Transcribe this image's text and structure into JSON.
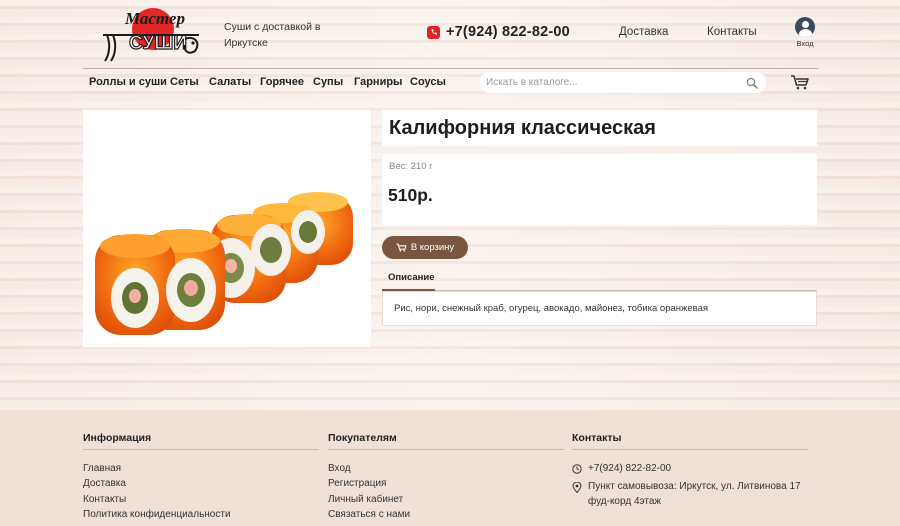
{
  "header": {
    "logo_text_top": "Мастер",
    "logo_text_bottom": "СУШИ",
    "tagline": "Суши с доставкой в Иркутске",
    "phone": "+7(924) 822-82-00",
    "nav": [
      "Доставка",
      "Контакты"
    ],
    "login_label": "Вход"
  },
  "menu": {
    "categories": [
      "Роллы и суши",
      "Сеты",
      "Салаты",
      "Горячее",
      "Супы",
      "Гарниры",
      "Соусы"
    ],
    "search_placeholder": "Искать в каталоге..."
  },
  "product": {
    "title": "Калифорния классическая",
    "weight": "Вес: 210 г",
    "price": "510р.",
    "buy_label": "В корзину",
    "tab_label": "Описание",
    "description": "Рис, нори, снежный краб, огурец, авокадо, майонез, тобика оранжевая"
  },
  "footer": {
    "info": {
      "heading": "Информация",
      "links": [
        "Главная",
        "Доставка",
        "Контакты",
        "Политика конфиденциальности"
      ]
    },
    "customers": {
      "heading": "Покупателям",
      "links": [
        "Вход",
        "Регистрация",
        "Личный кабинет",
        "Связаться с нами"
      ]
    },
    "contacts": {
      "heading": "Контакты",
      "phone": "+7(924) 822-82-00",
      "address": "Пункт самовывоза: Иркутск, ул. Литвинова 17 фуд-корд 4этаж"
    }
  },
  "colors": {
    "accent": "#7a5640",
    "phone_icon": "#e02424",
    "footer_bg": "#efe0d8"
  }
}
